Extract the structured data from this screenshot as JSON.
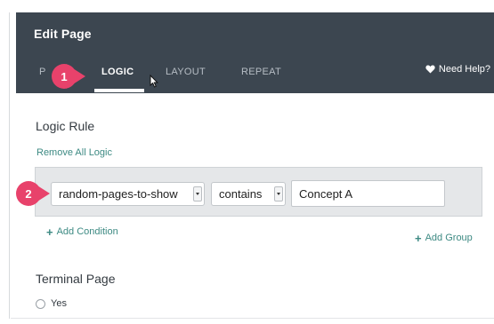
{
  "header": {
    "title": "Edit Page",
    "tabs": [
      {
        "label": "P",
        "active": false
      },
      {
        "label": "LOGIC",
        "active": true
      },
      {
        "label": "LAYOUT",
        "active": false
      },
      {
        "label": "REPEAT",
        "active": false
      }
    ],
    "help_label": "Need Help?",
    "help_icon": "heart-icon"
  },
  "callouts": [
    "1",
    "2"
  ],
  "logic_rule": {
    "title": "Logic Rule",
    "remove_all_label": "Remove All Logic",
    "condition": {
      "variable": "random-pages-to-show",
      "operator": "contains",
      "value": "Concept A"
    },
    "add_condition_label": "Add Condition",
    "add_group_label": "Add Group"
  },
  "terminal_page": {
    "title": "Terminal Page",
    "option_yes": "Yes"
  },
  "colors": {
    "header_bg": "#3c4650",
    "accent_link": "#3d8a83",
    "callout": "#e8426b"
  }
}
